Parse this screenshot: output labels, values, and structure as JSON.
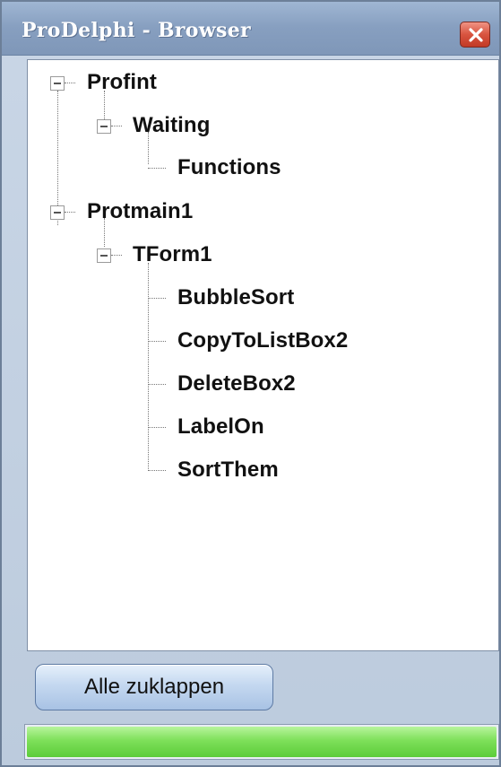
{
  "window": {
    "title": "ProDelphi - Browser"
  },
  "tree": {
    "nodes": [
      {
        "label": "Profint",
        "level": 0,
        "expanded": true
      },
      {
        "label": "Waiting",
        "level": 1,
        "expanded": true
      },
      {
        "label": "Functions",
        "level": 2
      },
      {
        "label": "Protmain1",
        "level": 0,
        "expanded": true
      },
      {
        "label": "TForm1",
        "level": 1,
        "expanded": true
      },
      {
        "label": "BubbleSort",
        "level": 2
      },
      {
        "label": "CopyToListBox2",
        "level": 2
      },
      {
        "label": "DeleteBox2",
        "level": 2
      },
      {
        "label": "LabelOn",
        "level": 2
      },
      {
        "label": "SortThem",
        "level": 2
      }
    ]
  },
  "footer": {
    "collapse_all_label": "Alle zuklappen",
    "progress_percent": 100
  },
  "colors": {
    "progress": "#6fd84a",
    "close_button": "#d8543f"
  }
}
